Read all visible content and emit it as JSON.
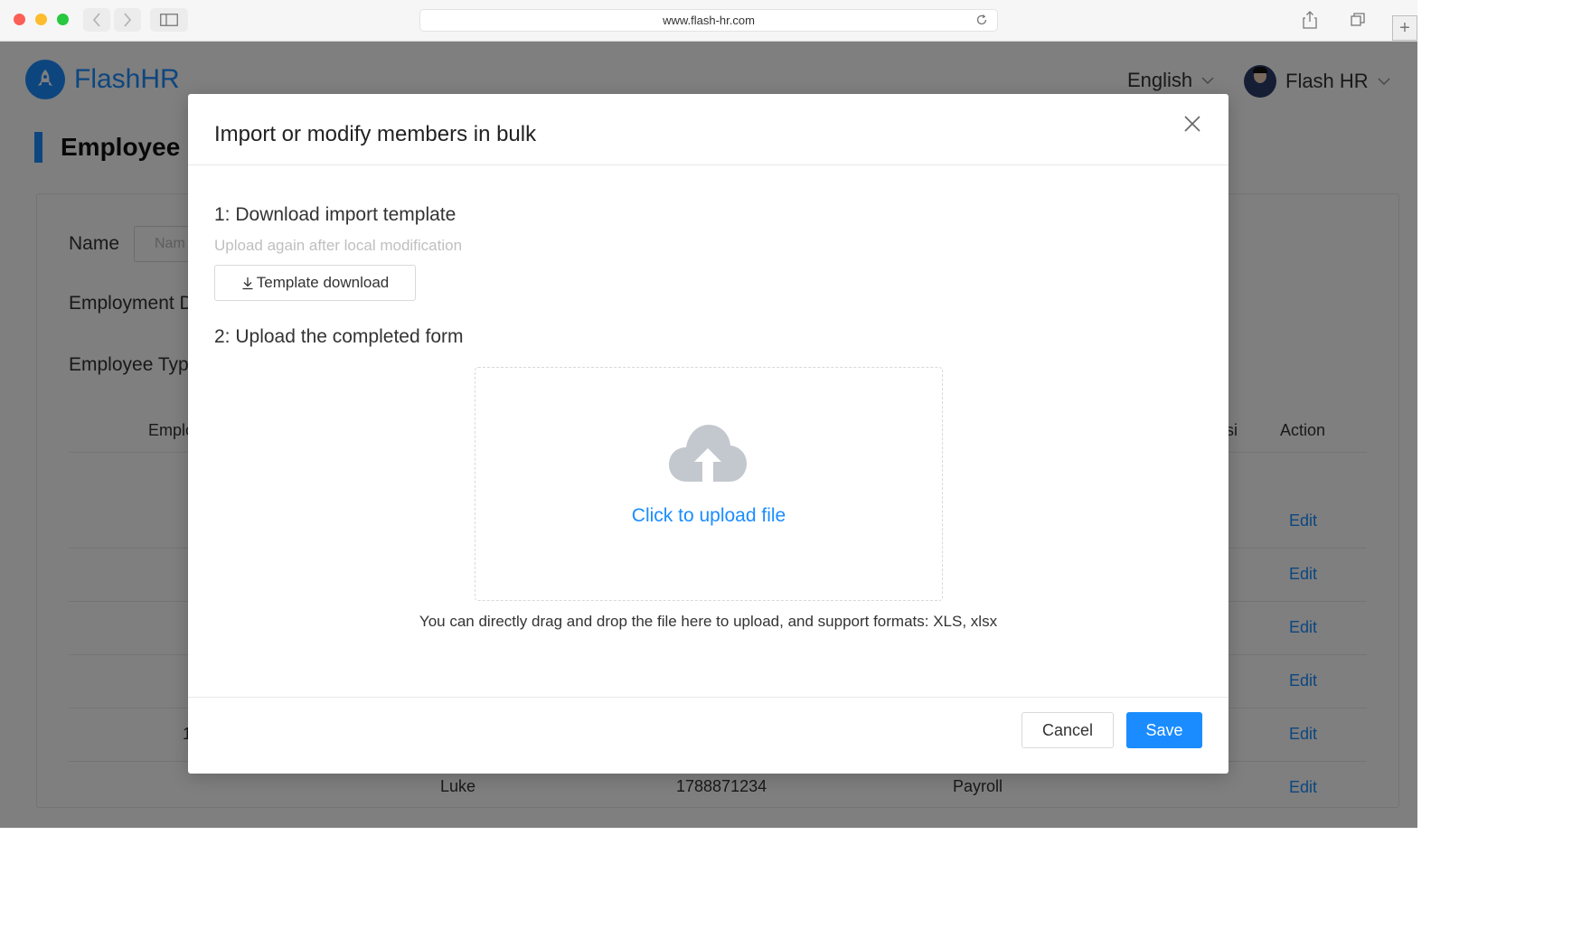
{
  "browser": {
    "url": "www.flash-hr.com"
  },
  "app": {
    "logo_text": "FlashHR",
    "language": "English",
    "user_name": "Flash HR",
    "page_title": "Employee I",
    "filters": {
      "name_label": "Name",
      "name_placeholder": "Nam",
      "employment_label": "Employment D",
      "type_label": "Employee Typ"
    },
    "table": {
      "headers": {
        "employee": "Emplo",
        "position": "si",
        "action": "Action"
      },
      "row_cells": {
        "partial_digit": "1",
        "last_row_name": "Luke",
        "last_row_phone": "1788871234",
        "last_row_type": "Payroll"
      },
      "edit_label": "Edit",
      "edit_rows": [
        "Edit",
        "Edit",
        "Edit",
        "Edit",
        "Edit",
        "Edit"
      ]
    }
  },
  "modal": {
    "title": "Import or modify members in bulk",
    "step1_title": "1: Download import template",
    "step1_hint": "Upload again after local modification",
    "template_button": "Template download",
    "step2_title": "2: Upload the completed form",
    "upload_text": "Click to upload file",
    "drag_hint": "You can directly drag and drop the file here to upload, and support formats: XLS, xlsx",
    "cancel_label": "Cancel",
    "save_label": "Save",
    "accent_color": "#1a8cff"
  }
}
